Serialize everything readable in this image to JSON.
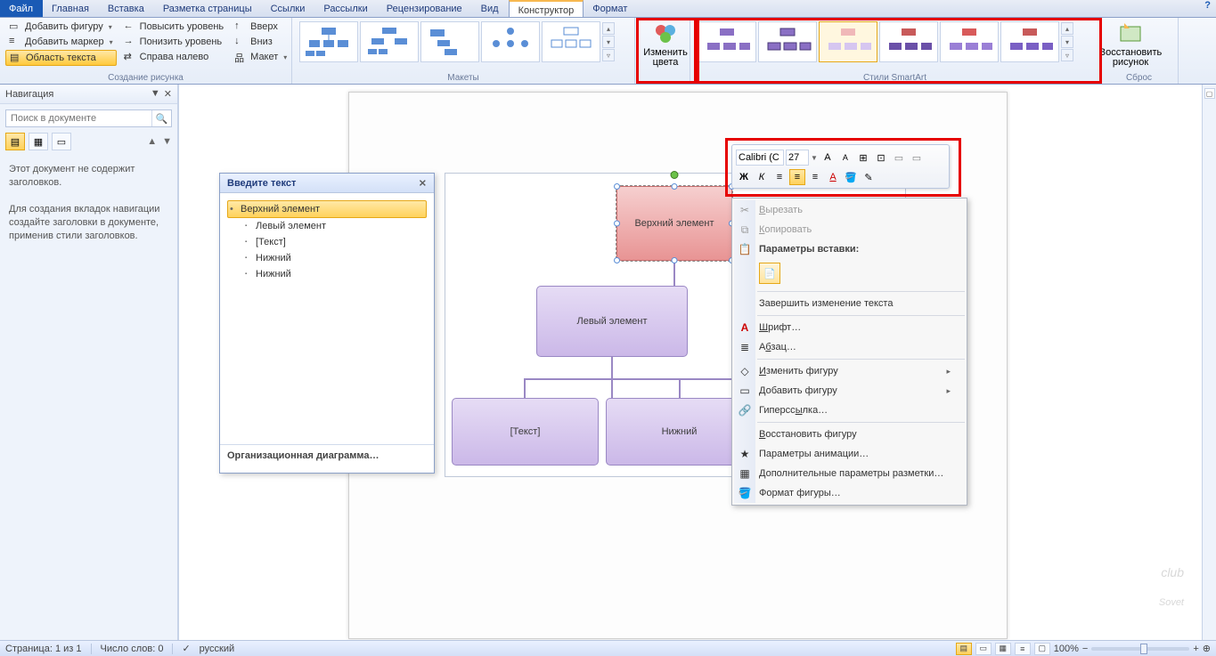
{
  "tabs": {
    "file": "Файл",
    "items": [
      "Главная",
      "Вставка",
      "Разметка страницы",
      "Ссылки",
      "Рассылки",
      "Рецензирование",
      "Вид",
      "Конструктор",
      "Формат"
    ],
    "active": "Конструктор"
  },
  "ribbon": {
    "group1": {
      "label": "Создание рисунка",
      "add_shape": "Добавить фигуру",
      "add_bullet": "Добавить маркер",
      "text_area": "Область текста",
      "promote": "Повысить уровень",
      "demote": "Понизить уровень",
      "rtl": "Справа налево",
      "up": "Вверх",
      "down": "Вниз",
      "layout": "Макет"
    },
    "group2": {
      "label": "Макеты"
    },
    "change_colors": "Изменить цвета",
    "group3": {
      "label": "Стили SmartArt"
    },
    "reset": {
      "label": "Сброс",
      "btn": "Восстановить рисунок"
    }
  },
  "nav": {
    "title": "Навигация",
    "search_placeholder": "Поиск в документе",
    "msg1": "Этот документ не содержит заголовков.",
    "msg2": "Для создания вкладок навигации создайте заголовки в документе, применив стили заголовков."
  },
  "text_pane": {
    "title": "Введите текст",
    "items": [
      {
        "t": "Верхний элемент",
        "sel": true,
        "sub": false
      },
      {
        "t": "Левый элемент",
        "sub": true
      },
      {
        "t": "[Текст]",
        "sub": true
      },
      {
        "t": "Нижний",
        "sub": true
      },
      {
        "t": "Нижний",
        "sub": true
      }
    ],
    "footer": "Организационная диаграмма…"
  },
  "smartart": {
    "top": "Верхний элемент",
    "left": "Левый элемент",
    "b1": "[Текст]",
    "b2": "Нижний"
  },
  "mini": {
    "font": "Calibri (C",
    "size": "27"
  },
  "ctx": {
    "cut": "Вырезать",
    "copy": "Копировать",
    "paste_opts": "Параметры вставки:",
    "end_edit": "Завершить изменение текста",
    "font": "Шрифт…",
    "para": "Абзац…",
    "change_shape": "Изменить фигуру",
    "add_shape": "Добавить фигуру",
    "hyperlink": "Гиперссылка…",
    "restore": "Восстановить фигуру",
    "anim": "Параметры анимации…",
    "layout_params": "Дополнительные параметры разметки…",
    "format_shape": "Формат фигуры…"
  },
  "status": {
    "page": "Страница: 1 из 1",
    "words": "Число слов: 0",
    "lang": "русский",
    "zoom": "100%"
  },
  "watermark": {
    "big": "Sovet",
    "small": "club"
  }
}
